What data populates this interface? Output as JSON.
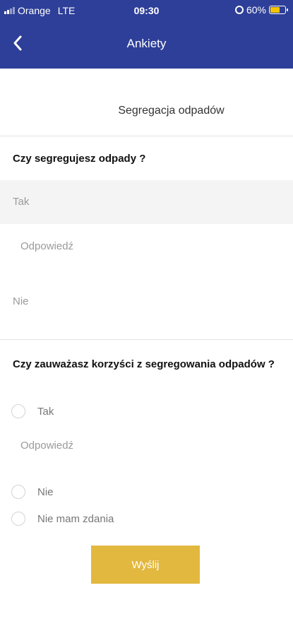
{
  "status_bar": {
    "carrier": "Orange",
    "network": "LTE",
    "time": "09:30",
    "battery": "60%"
  },
  "nav": {
    "title": "Ankiety",
    "back_icon": "chevron-left-icon"
  },
  "survey": {
    "title": "Segregacja odpadów",
    "q1": {
      "question": "Czy segregujesz odpady ?",
      "options": [
        "Tak",
        "Nie"
      ],
      "selected": "Tak",
      "answer_placeholder": "Odpowiedź"
    },
    "q2": {
      "question": "Czy zauważasz korzyści z segregowania odpadów ?",
      "options": [
        "Tak",
        "Nie",
        "Nie mam zdania"
      ],
      "answer_placeholder": "Odpowiedź"
    }
  },
  "submit_label": "Wyślij",
  "colors": {
    "header": "#2e3f99",
    "submit": "#e2b83e",
    "battery": "#f5c400"
  }
}
